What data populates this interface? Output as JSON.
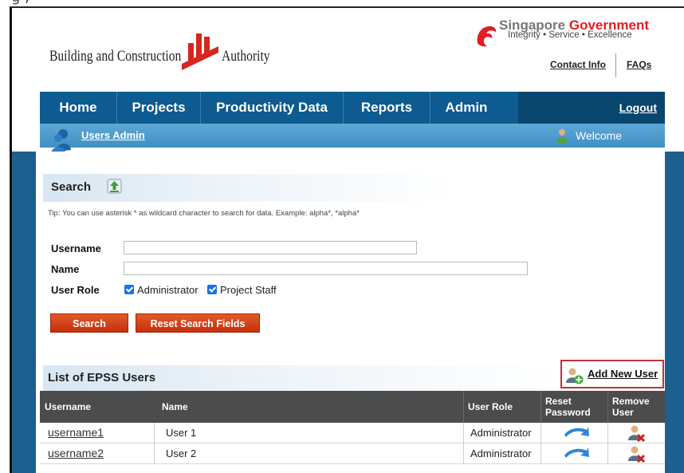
{
  "top_partial": "g                   ,",
  "header": {
    "bca_name_left": "Building and Construction",
    "bca_name_right": "Authority",
    "sg_title_part1": "Singapore",
    "sg_title_part2": "Government",
    "sg_tagline": "Integrity • Service • Excellence",
    "contact_label": "Contact Info",
    "faq_label": "FAQs"
  },
  "nav": {
    "items": [
      "Home",
      "Projects",
      "Productivity Data",
      "Reports",
      "Admin"
    ],
    "logout": "Logout"
  },
  "subnav": {
    "link": "Users Admin",
    "welcome": "Welcome"
  },
  "search": {
    "title": "Search",
    "tip": "Tip: You can use asterisk * as wildcard character to search for data. Example: alpha*, *alpha*",
    "username_label": "Username",
    "username_value": "",
    "name_label": "Name",
    "name_value": "",
    "role_label": "User Role",
    "role_options": [
      "Administrator",
      "Project Staff"
    ],
    "search_button": "Search",
    "reset_button": "Reset Search Fields"
  },
  "list": {
    "title": "List of EPSS Users",
    "add_new": "Add New User",
    "columns": [
      "Username",
      "Name",
      "User Role",
      "Reset Password",
      "Remove User"
    ],
    "rows": [
      {
        "username": "username1",
        "name": "User 1",
        "role": "Administrator"
      },
      {
        "username": "username2",
        "name": "User 2",
        "role": "Administrator"
      }
    ]
  },
  "colors": {
    "nav_bg": "#0d5b90",
    "subnav_bg": "#4a9bd0",
    "button_red": "#d4421a",
    "highlight_box": "#c0323a",
    "table_header": "#4c4c4c"
  }
}
